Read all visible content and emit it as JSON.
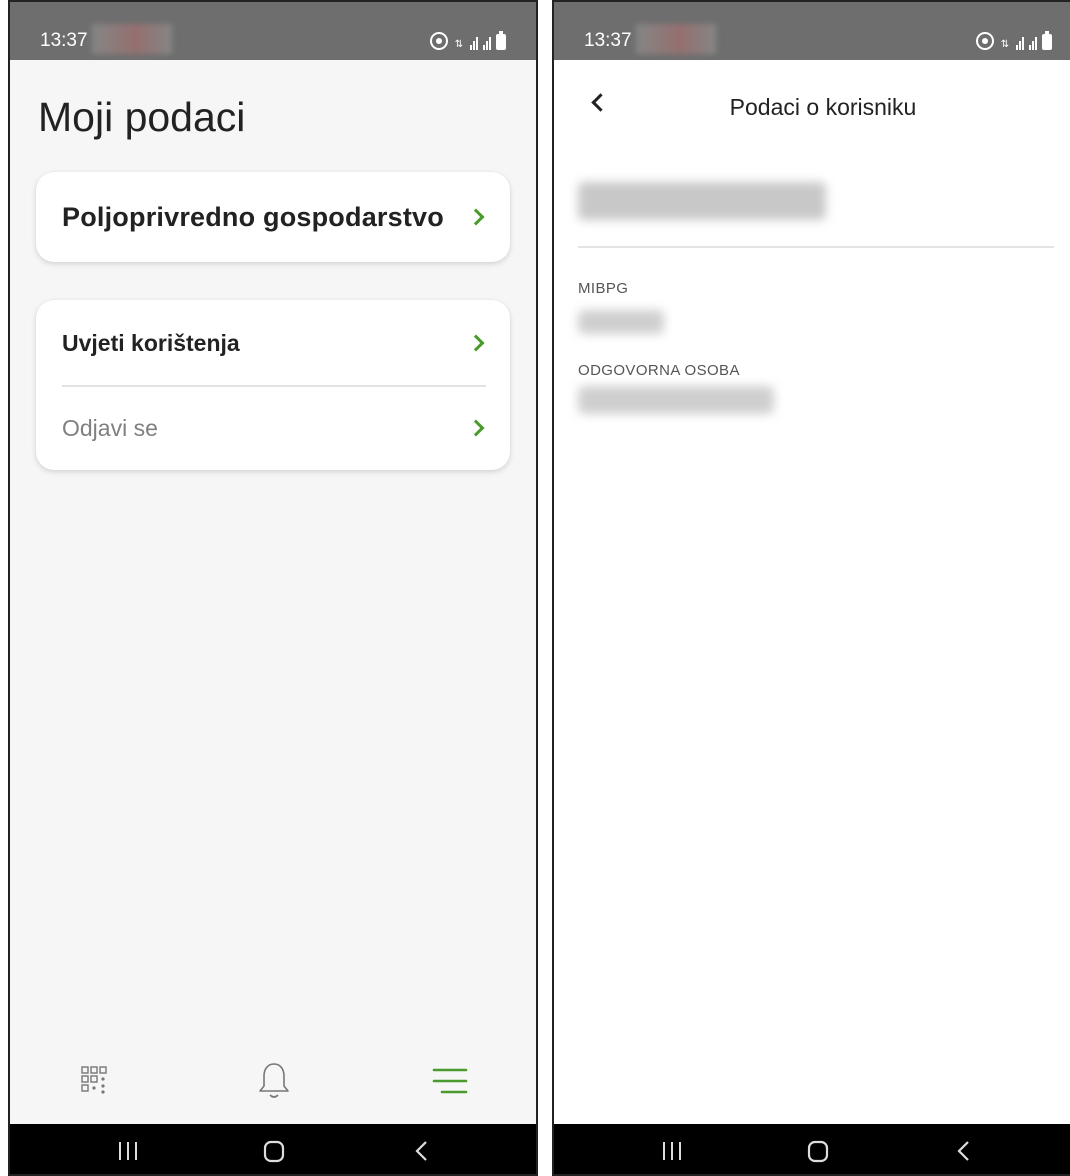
{
  "status_bar": {
    "time": "13:37",
    "icons": [
      "hotspot-icon",
      "data-4g-icon",
      "signal-bars-icon",
      "signal-bars-icon",
      "battery-icon"
    ]
  },
  "left_screen": {
    "title": "Moji podaci",
    "farm_card": {
      "label": "Poljoprivredno gospodarstvo"
    },
    "menu_card": {
      "items": [
        {
          "label": "Uvjeti korištenja"
        },
        {
          "label": "Odjavi se"
        }
      ]
    },
    "bottom_nav": {
      "items": [
        {
          "icon": "grid-icon",
          "active": false
        },
        {
          "icon": "bell-icon",
          "active": false
        },
        {
          "icon": "menu-icon",
          "active": true
        }
      ]
    }
  },
  "right_screen": {
    "header_title": "Podaci o korisniku",
    "fields": [
      {
        "label": "MIBPG"
      },
      {
        "label": "ODGOVORNA OSOBA"
      }
    ]
  },
  "system_nav": {
    "icons": [
      "recent-apps-icon",
      "home-icon",
      "back-icon"
    ]
  },
  "colors": {
    "accent": "#4a9a2d",
    "status_bar": "#6e6e6e",
    "page_bg": "#f6f6f6",
    "card_bg": "#ffffff",
    "text_primary": "#222222",
    "text_muted": "#808080",
    "system_nav_bg": "#000000"
  }
}
